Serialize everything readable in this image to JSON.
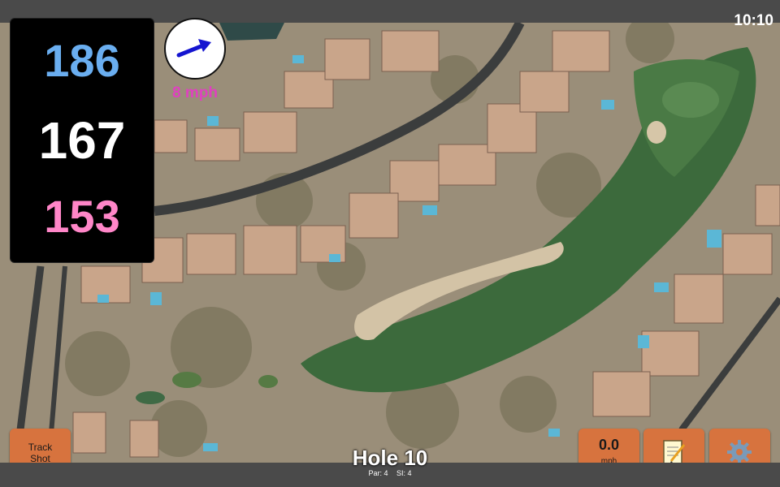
{
  "status": {
    "clock": "10:10"
  },
  "distances": {
    "back": "186",
    "middle": "167",
    "front": "153"
  },
  "wind": {
    "speed_label": "8 mph",
    "icon": "wind-direction-arrow-icon"
  },
  "buttons": {
    "track_line1": "Track",
    "track_line2": "Shot",
    "wind_value": "0.0",
    "wind_unit": "mph",
    "notes_icon": "notepad-icon",
    "settings_icon": "gear-icon"
  },
  "hole": {
    "title": "Hole 10",
    "par": "Par: 4",
    "si": "SI: 4"
  },
  "colors": {
    "back_distance": "#6aaef0",
    "middle_distance": "#ffffff",
    "front_distance": "#ff86c8",
    "wind_label": "#e040c0",
    "button": "#d7733e"
  }
}
